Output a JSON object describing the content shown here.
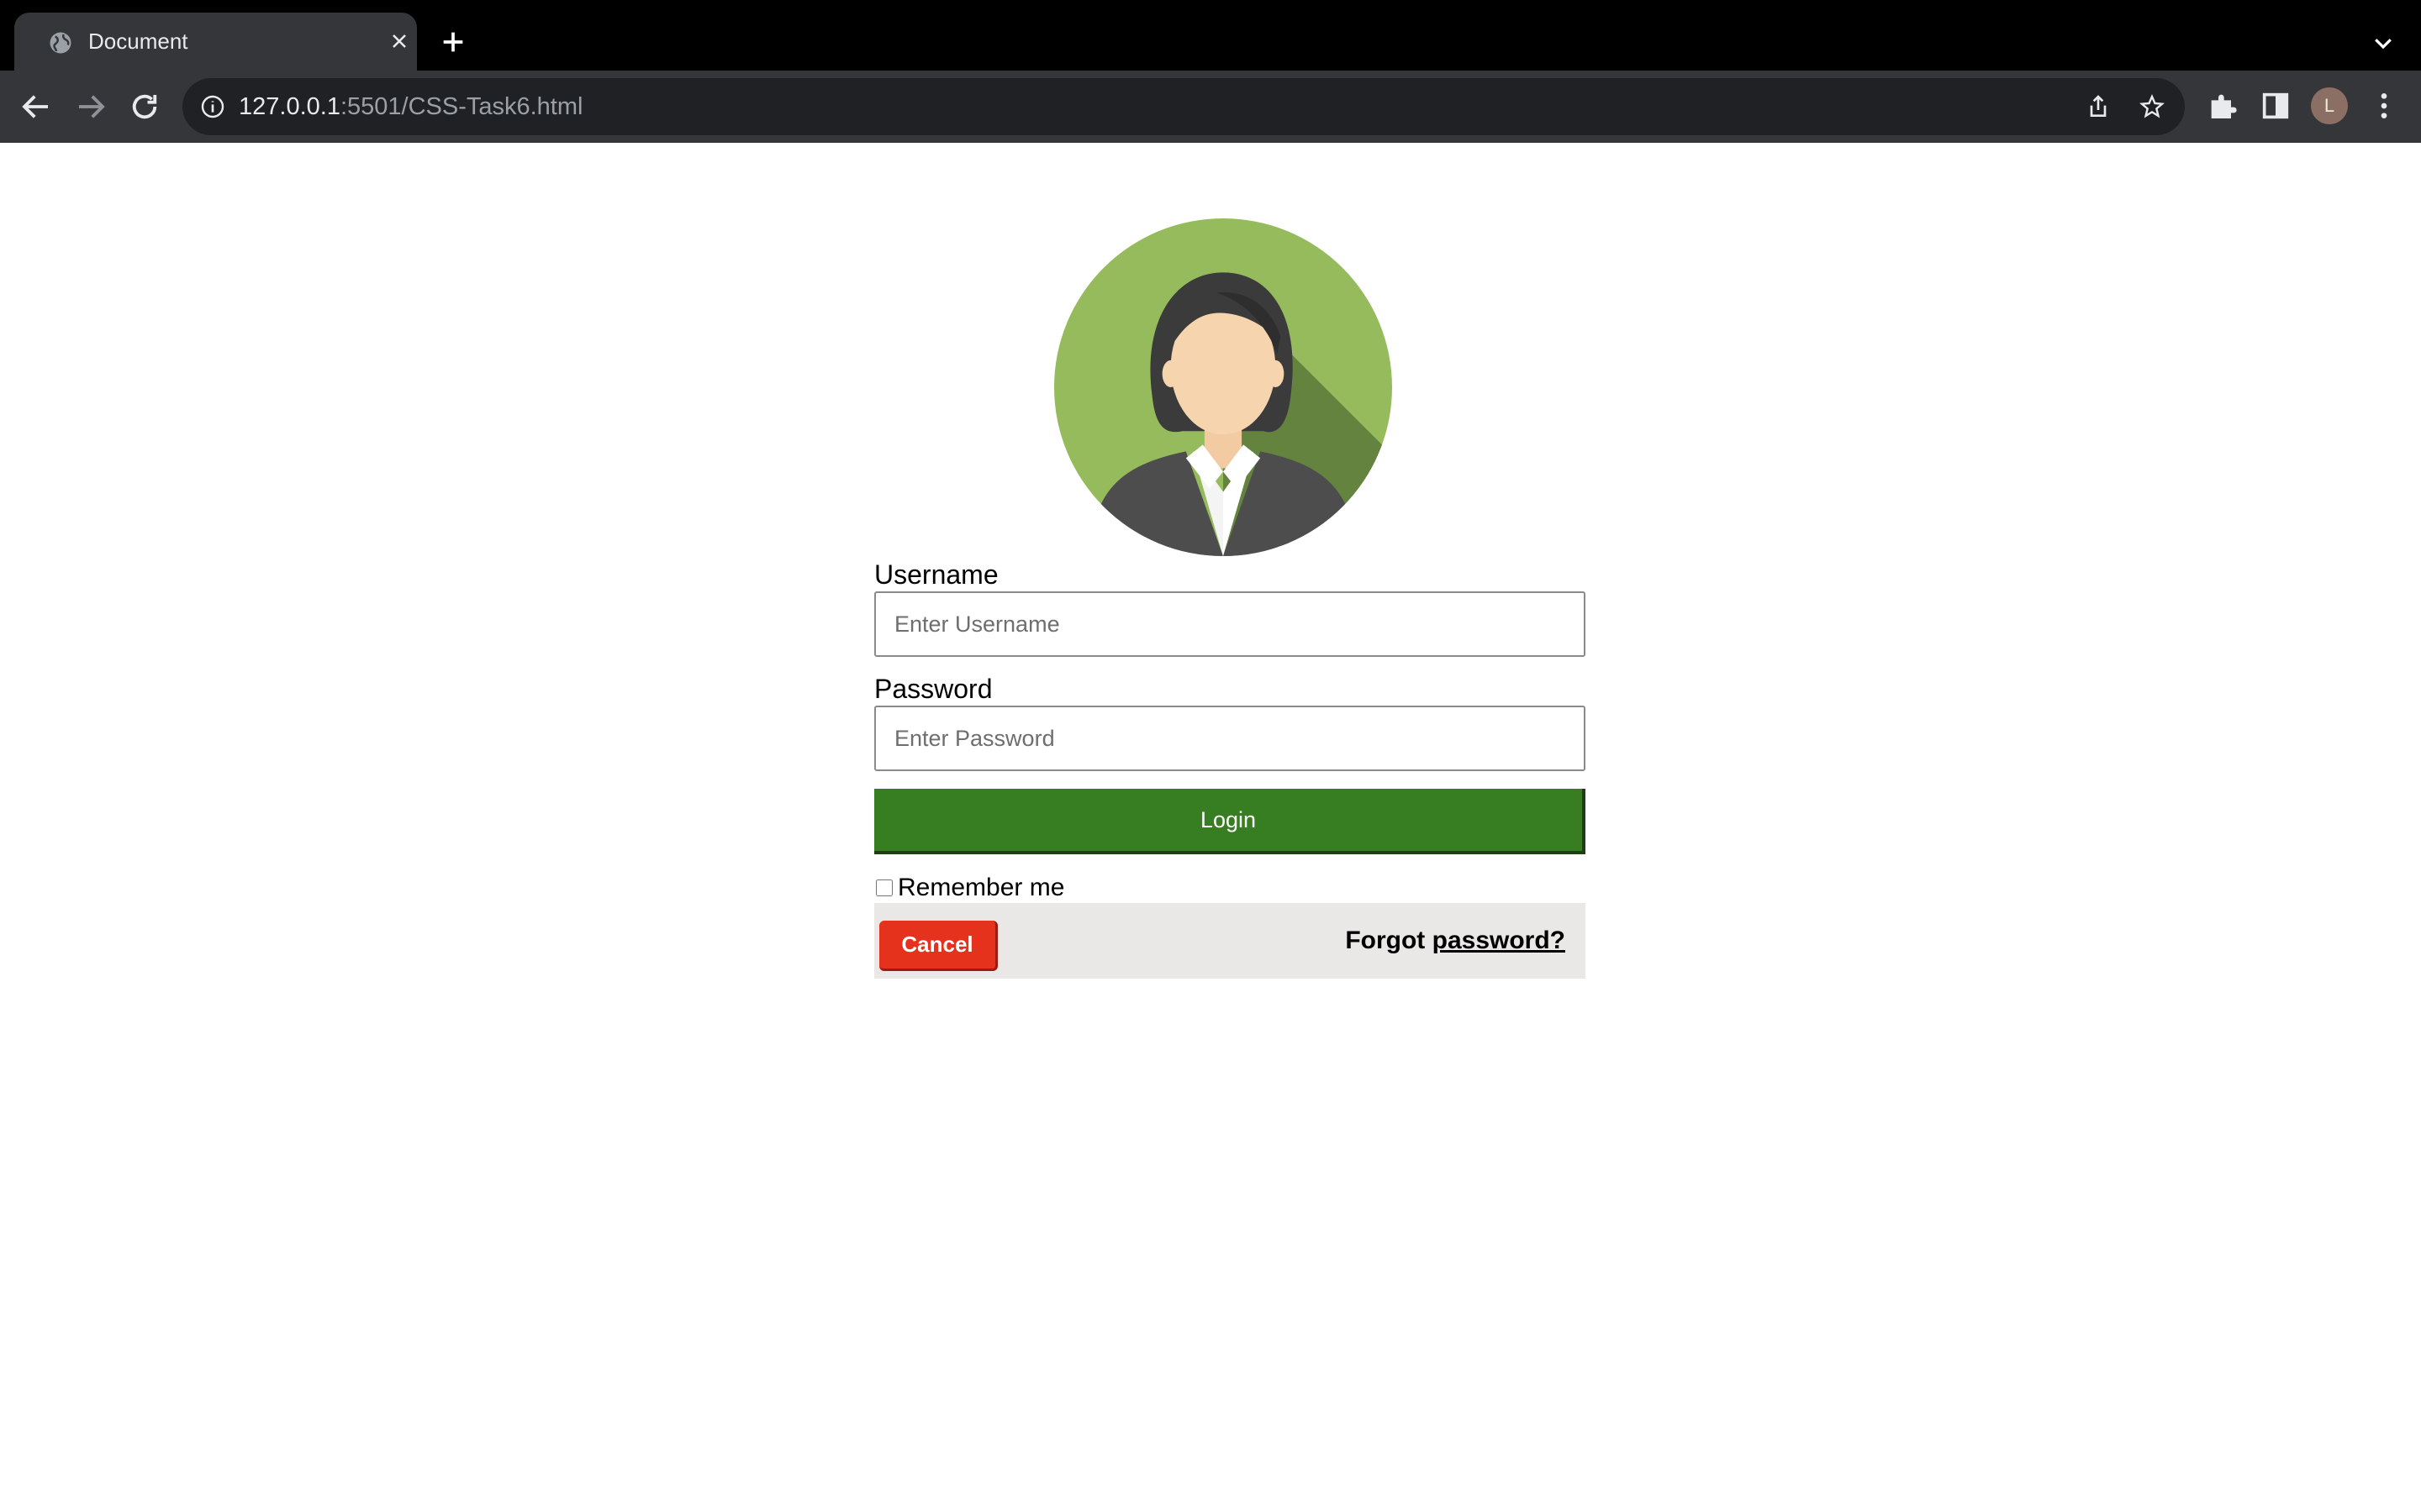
{
  "browser": {
    "tab_title": "Document",
    "url_host": "127.0.0.1",
    "url_path": ":5501/CSS-Task6.html",
    "profile_initial": "L",
    "icons": [
      "globe-icon",
      "close-icon",
      "plus-icon",
      "chevron-down-icon",
      "back-arrow-icon",
      "forward-arrow-icon",
      "reload-icon",
      "info-icon",
      "share-icon",
      "star-icon",
      "puzzle-icon",
      "sidepanel-icon",
      "kebab-menu-icon"
    ]
  },
  "form": {
    "avatar_icon": "female-avatar-icon",
    "username_label": "Username",
    "username_placeholder": "Enter Username",
    "password_label": "Password",
    "password_placeholder": "Enter Password",
    "login_label": "Login",
    "remember_label": "Remember me",
    "cancel_label": "Cancel",
    "forgot_prefix": "Forgot ",
    "forgot_link": "password?"
  },
  "colors": {
    "login_green": "#377d22",
    "cancel_red": "#e5321d",
    "footer_bg": "#e9e8e6",
    "avatar_green": "#96bb5c"
  }
}
